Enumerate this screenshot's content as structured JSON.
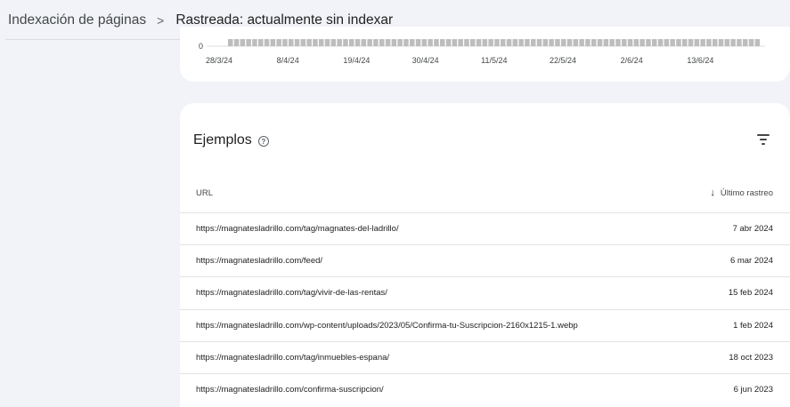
{
  "header": {
    "breadcrumb_parent": "Indexación de páginas",
    "separator": ">",
    "current": "Rastreada: actualmente sin indexar"
  },
  "chart": {
    "y_zero_label": "0",
    "x_labels": [
      "28/3/24",
      "8/4/24",
      "19/4/24",
      "30/4/24",
      "11/5/24",
      "22/5/24",
      "2/6/24",
      "13/6/24"
    ],
    "bar_color": "#bdbdbd"
  },
  "examples": {
    "title": "Ejemplos",
    "help_icon": "?",
    "columns": {
      "url": "URL",
      "date": "Último rastreo",
      "sort_icon": "↓"
    },
    "rows": [
      {
        "url": "https://magnatesladrillo.com/tag/magnates-del-ladrillo/",
        "date": "7 abr 2024"
      },
      {
        "url": "https://magnatesladrillo.com/feed/",
        "date": "6 mar 2024"
      },
      {
        "url": "https://magnatesladrillo.com/tag/vivir-de-las-rentas/",
        "date": "15 feb 2024"
      },
      {
        "url": "https://magnatesladrillo.com/wp-content/uploads/2023/05/Confirma-tu-Suscripcion-2160x1215-1.webp",
        "date": "1 feb 2024"
      },
      {
        "url": "https://magnatesladrillo.com/tag/inmuebles-espana/",
        "date": "18 oct 2023"
      },
      {
        "url": "https://magnatesladrillo.com/confirma-suscripcion/",
        "date": "6 jun 2023"
      }
    ]
  }
}
